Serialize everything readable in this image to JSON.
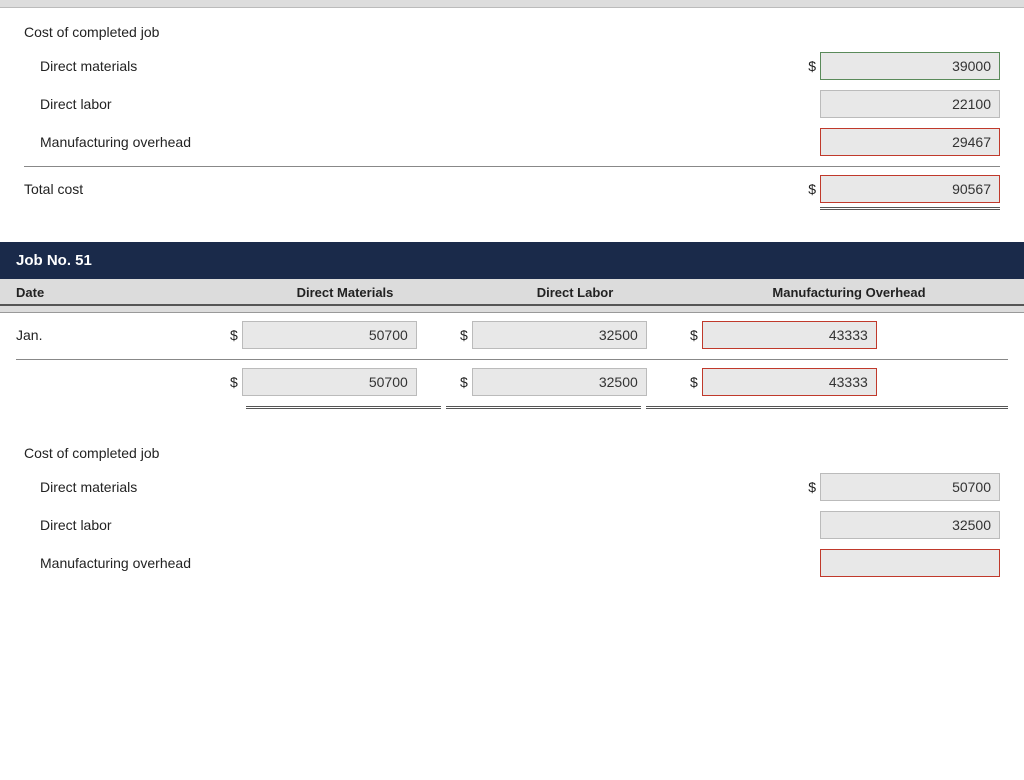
{
  "top_section": {
    "title": "Cost of completed job",
    "rows": [
      {
        "label": "Direct materials",
        "show_dollar": true,
        "value": "39000",
        "border": "green"
      },
      {
        "label": "Direct labor",
        "show_dollar": false,
        "value": "22100",
        "border": "normal"
      },
      {
        "label": "Manufacturing overhead",
        "show_dollar": false,
        "value": "29467",
        "border": "red"
      }
    ],
    "total_label": "Total cost",
    "total_value": "90567"
  },
  "job51": {
    "title": "Job No. 51",
    "columns": {
      "date": "Date",
      "direct_materials": "Direct Materials",
      "direct_labor": "Direct Labor",
      "manufacturing_overhead": "Manufacturing Overhead"
    },
    "rows": [
      {
        "date": "Jan.",
        "dm_value": "50700",
        "dl_value": "32500",
        "moh_value": "43333",
        "moh_border": "red"
      }
    ],
    "subtotal": {
      "dm_value": "50700",
      "dl_value": "32500",
      "moh_value": "43333",
      "moh_border": "red"
    }
  },
  "bottom_section": {
    "title": "Cost of completed job",
    "rows": [
      {
        "label": "Direct materials",
        "show_dollar": true,
        "value": "50700",
        "border": "normal"
      },
      {
        "label": "Direct labor",
        "show_dollar": false,
        "value": "32500",
        "border": "normal"
      },
      {
        "label": "Manufacturing overhead",
        "show_dollar": false,
        "value": "",
        "border": "red"
      }
    ]
  }
}
